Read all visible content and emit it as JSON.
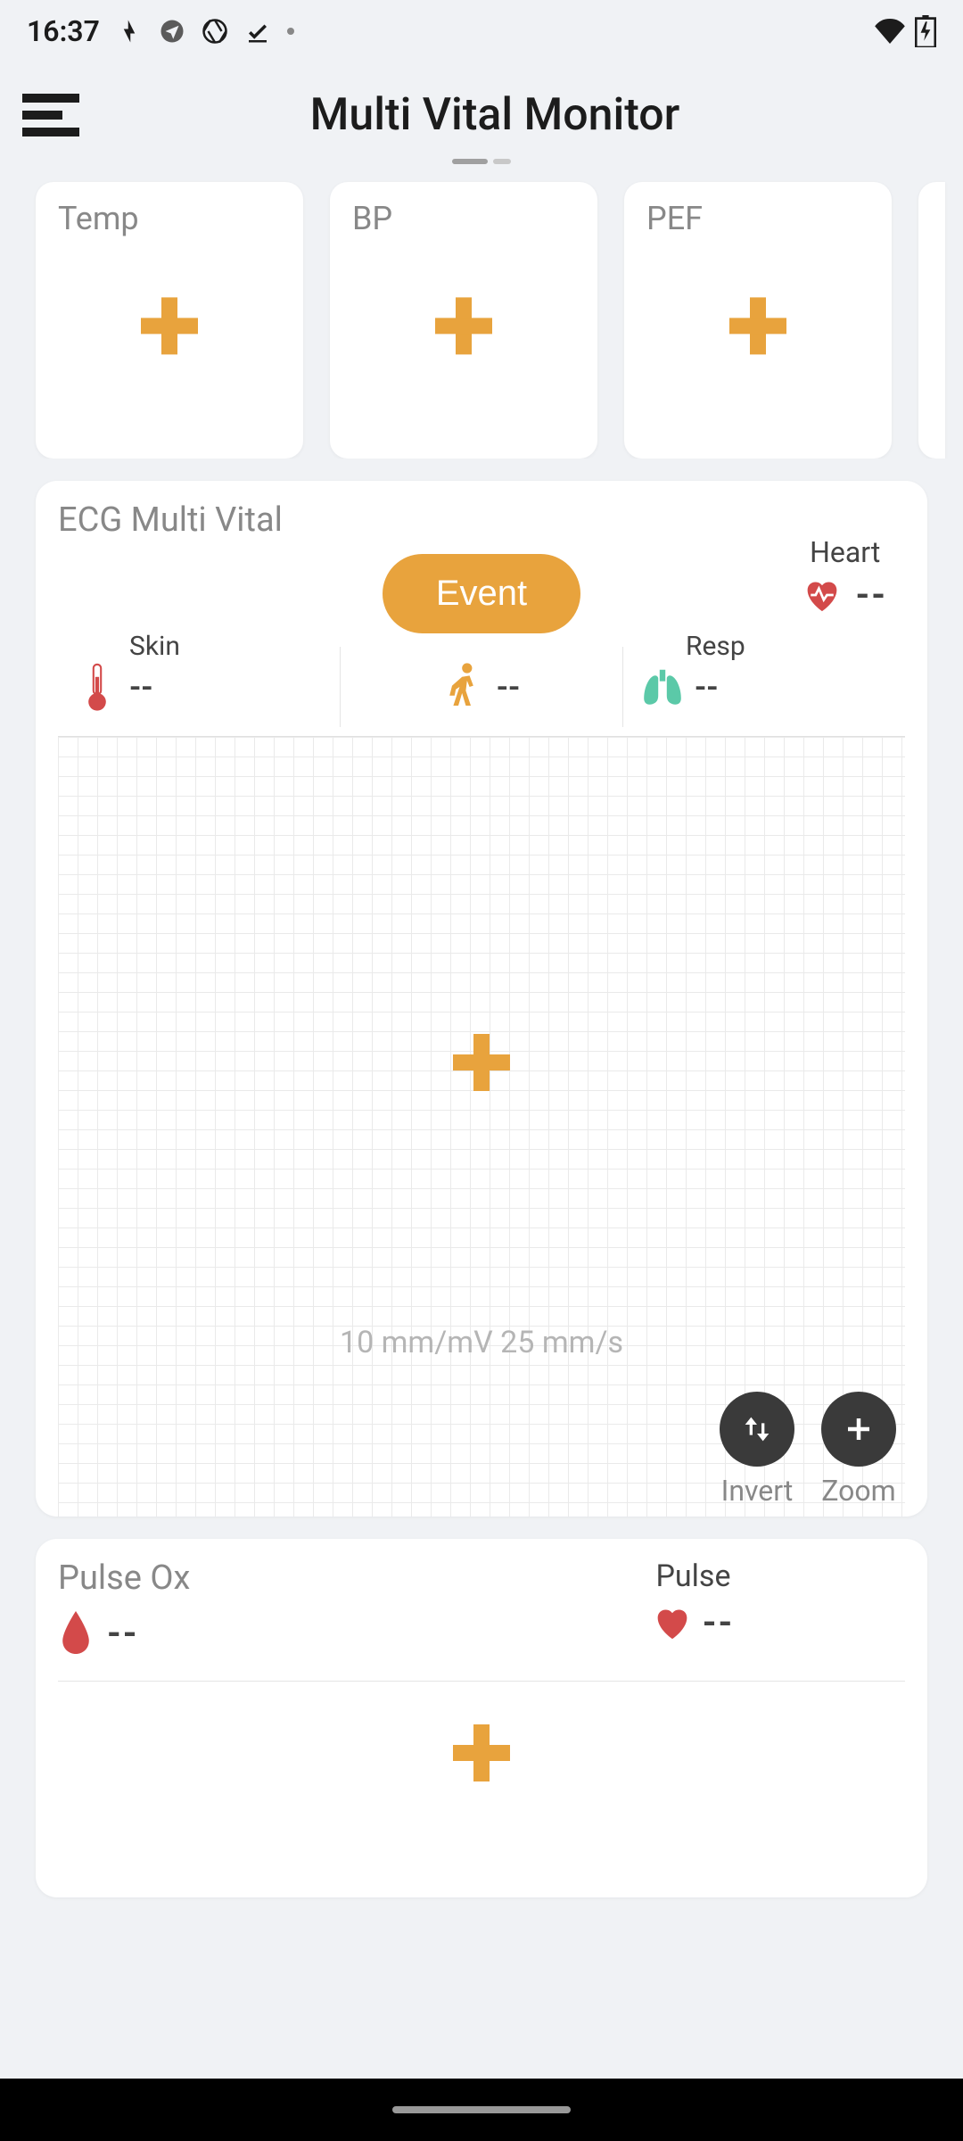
{
  "status": {
    "time": "16:37"
  },
  "header": {
    "title": "Multi Vital Monitor"
  },
  "cards": {
    "temp": {
      "label": "Temp"
    },
    "bp": {
      "label": "BP"
    },
    "pef": {
      "label": "PEF"
    }
  },
  "ecg": {
    "title": "ECG Multi Vital",
    "event_label": "Event",
    "heart": {
      "label": "Heart",
      "value": "--"
    },
    "skin": {
      "label": "Skin",
      "value": "--"
    },
    "walk": {
      "value": "--"
    },
    "resp": {
      "label": "Resp",
      "value": "--"
    },
    "scale": "10 mm/mV 25 mm/s",
    "invert_label": "Invert",
    "zoom_label": "Zoom"
  },
  "pulseox": {
    "title": "Pulse Ox",
    "spo2_value": "--",
    "pulse_label": "Pulse",
    "pulse_value": "--"
  }
}
